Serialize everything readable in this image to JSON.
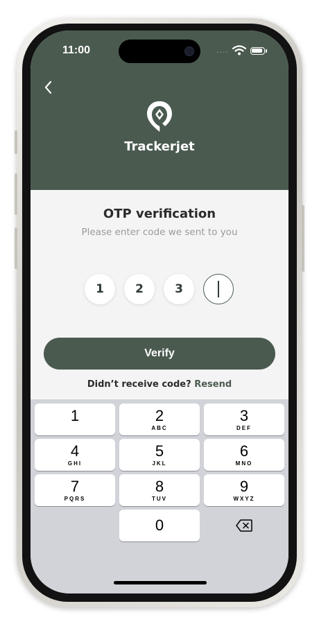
{
  "status_bar": {
    "time": "11:00",
    "signal_dots": "....",
    "wifi_icon": "wifi-icon",
    "battery_icon": "battery-icon"
  },
  "header": {
    "back_icon": "chevron-left-icon",
    "logo_icon": "location-pin-icon",
    "brand_name": "Trackerjet",
    "background_color": "#4a5a4f"
  },
  "otp": {
    "title": "OTP verification",
    "subtitle": "Please enter code we sent to you",
    "digits": [
      "1",
      "2",
      "3",
      ""
    ],
    "active_index": 3
  },
  "verify_button": {
    "label": "Verify"
  },
  "resend": {
    "prompt": "Didn’t receive code?",
    "link": "Resend"
  },
  "keypad": {
    "keys": [
      {
        "num": "1",
        "letters": ""
      },
      {
        "num": "2",
        "letters": "ABC"
      },
      {
        "num": "3",
        "letters": "DEF"
      },
      {
        "num": "4",
        "letters": "GHI"
      },
      {
        "num": "5",
        "letters": "JKL"
      },
      {
        "num": "6",
        "letters": "MNO"
      },
      {
        "num": "7",
        "letters": "PQRS"
      },
      {
        "num": "8",
        "letters": "TUV"
      },
      {
        "num": "9",
        "letters": "WXYZ"
      },
      {
        "num": "0",
        "letters": ""
      }
    ],
    "delete_icon": "backspace-icon"
  },
  "colors": {
    "accent": "#4a5a4f",
    "keypad_bg": "#d1d3d9",
    "screen_bg": "#f4f4f4"
  }
}
